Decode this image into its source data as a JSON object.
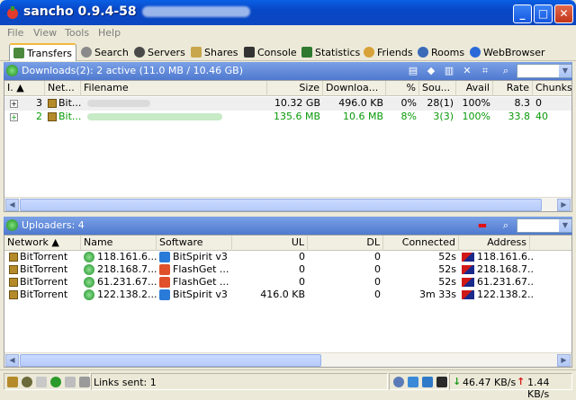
{
  "window": {
    "title": "sancho 0.9.4-58",
    "buttons": {
      "minimize": "_",
      "maximize": "□",
      "close": "✕"
    }
  },
  "menu": [
    "File",
    "View",
    "Tools",
    "Help"
  ],
  "tabs": [
    {
      "label": "Transfers",
      "icon": "transfers-icon",
      "active": true
    },
    {
      "label": "Search",
      "icon": "search-icon"
    },
    {
      "label": "Servers",
      "icon": "servers-icon"
    },
    {
      "label": "Shares",
      "icon": "shares-icon"
    },
    {
      "label": "Console",
      "icon": "console-icon"
    },
    {
      "label": "Statistics",
      "icon": "statistics-icon"
    },
    {
      "label": "Friends",
      "icon": "friends-icon"
    },
    {
      "label": "Rooms",
      "icon": "rooms-icon"
    },
    {
      "label": "WebBrowser",
      "icon": "webbrowser-icon"
    }
  ],
  "downloads": {
    "title": "Downloads(2): 2 active (11.0 MB / 10.46 GB)",
    "columns": [
      "I.",
      "Net...",
      "Filename",
      "Size",
      "Downloa...",
      "%",
      "Sou...",
      "Avail",
      "Rate",
      "Chunks"
    ],
    "rows": [
      {
        "id": "3",
        "net": "Bit...",
        "filename": "",
        "size": "10.32 GB",
        "downloaded": "496.0 KB",
        "percent": "0%",
        "sources": "28(1)",
        "avail": "100%",
        "rate": "8.3",
        "chunks": "0",
        "color": "#000000"
      },
      {
        "id": "2",
        "net": "Bit...",
        "filename": "",
        "size": "135.6 MB",
        "downloaded": "10.6 MB",
        "percent": "8%",
        "sources": "3(3)",
        "avail": "100%",
        "rate": "33.8",
        "chunks": "40",
        "color": "#0a9a0a"
      }
    ]
  },
  "uploaders": {
    "title": "Uploaders: 4",
    "columns": [
      "Network",
      "Name",
      "Software",
      "UL",
      "DL",
      "Connected",
      "Address"
    ],
    "rows": [
      {
        "network": "BitTorrent",
        "name": "118.161.6...",
        "software": "BitSpirit v3",
        "ul": "0",
        "dl": "0",
        "connected": "52s",
        "address": "118.161.6..."
      },
      {
        "network": "BitTorrent",
        "name": "218.168.7...",
        "software": "FlashGet ...",
        "ul": "0",
        "dl": "0",
        "connected": "52s",
        "address": "218.168.7..."
      },
      {
        "network": "BitTorrent",
        "name": "61.231.67...",
        "software": "FlashGet ...",
        "ul": "0",
        "dl": "0",
        "connected": "52s",
        "address": "61.231.67..."
      },
      {
        "network": "BitTorrent",
        "name": "122.138.2...",
        "software": "BitSpirit v3",
        "ul": "416.0 KB",
        "dl": "0",
        "connected": "3m 33s",
        "address": "122.138.2..."
      }
    ]
  },
  "status": {
    "links_sent": "Links sent: 1",
    "down_rate": "46.47 KB/s",
    "up_rate": "1.44 KB/s"
  },
  "colors": {
    "title_bar": "#0a5fe4",
    "panel_head": "#5a80d2",
    "active_text": "#0a9a0a"
  }
}
